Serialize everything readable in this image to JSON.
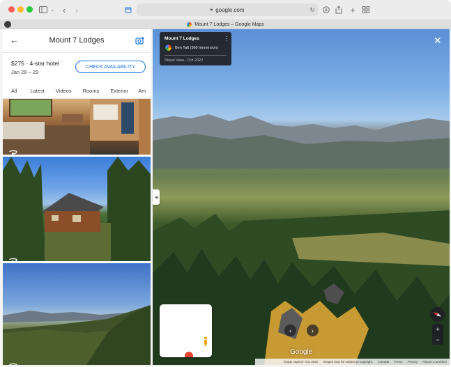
{
  "browser": {
    "url": "google.com",
    "tab_title": "Mount 7 Lodges – Google Maps"
  },
  "panel": {
    "title": "Mount 7 Lodges",
    "price": "$275 · 4-star hotel",
    "dates": "Jan 28 – 29",
    "check_button": "CHECK AVAILABILITY",
    "filters": [
      "All",
      "Latest",
      "Videos",
      "Rooms",
      "Exterior",
      "Am"
    ]
  },
  "streetview": {
    "place_title": "Mount 7 Lodges",
    "author": "Ben Taft (360 Immersion)",
    "date_label": "Street View - Oct 2022",
    "logo": "Google",
    "footer": {
      "capture": "Image capture: Oct 2022",
      "copyright": "Images may be subject to copyright.",
      "country": "Canada",
      "terms": "Terms",
      "privacy": "Privacy",
      "report": "Report a problem"
    }
  },
  "colors": {
    "accent": "#1a73e8",
    "card_bg": "#202124"
  }
}
